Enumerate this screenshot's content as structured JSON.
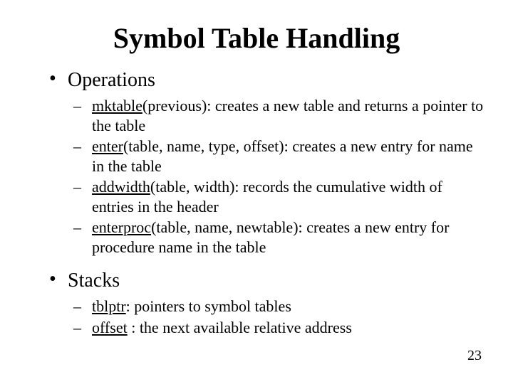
{
  "title": "Symbol Table Handling",
  "sections": [
    {
      "heading": "Operations",
      "items": [
        {
          "term": "mktable",
          "rest": "(previous): creates a new table and returns a pointer to the table"
        },
        {
          "term": "enter",
          "rest": "(table, name, type, offset): creates a new entry for name in the table"
        },
        {
          "term": "addwidth",
          "rest": "(table, width): records the cumulative width of entries in the header"
        },
        {
          "term": "enterproc",
          "rest": "(table, name, newtable): creates a new entry for procedure name in the table"
        }
      ]
    },
    {
      "heading": "Stacks",
      "items": [
        {
          "term": "tblptr",
          "rest": ": pointers to symbol tables"
        },
        {
          "term": "offset",
          "rest": " : the next available relative address"
        }
      ]
    }
  ],
  "page_number": "23"
}
